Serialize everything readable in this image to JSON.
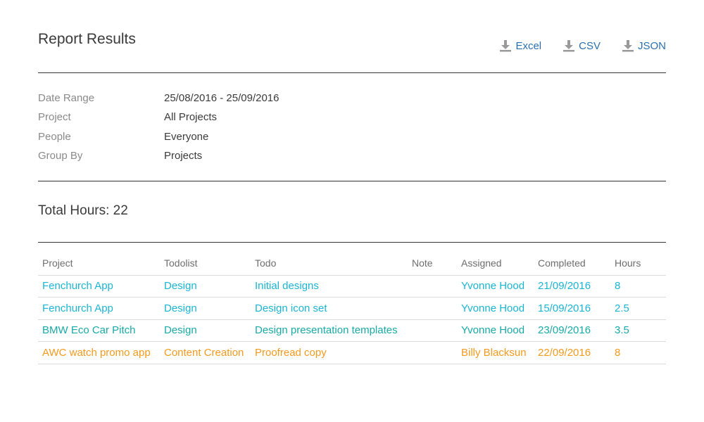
{
  "header": {
    "title": "Report Results",
    "exports": [
      {
        "label": "Excel",
        "icon": "download-icon"
      },
      {
        "label": "CSV",
        "icon": "download-icon"
      },
      {
        "label": "JSON",
        "icon": "download-icon"
      }
    ]
  },
  "filters": [
    {
      "label": "Date Range",
      "value": "25/08/2016 - 25/09/2016"
    },
    {
      "label": "Project",
      "value": "All Projects"
    },
    {
      "label": "People",
      "value": "Everyone"
    },
    {
      "label": "Group By",
      "value": "Projects"
    }
  ],
  "total": {
    "text": "Total Hours: 22"
  },
  "table": {
    "columns": [
      "Project",
      "Todolist",
      "Todo",
      "Note",
      "Assigned",
      "Completed",
      "Hours"
    ],
    "rows": [
      {
        "color": "#1bb5d3",
        "cells": [
          "Fenchurch App",
          "Design",
          "Initial designs",
          "",
          "Yvonne Hood",
          "21/09/2016",
          "8"
        ]
      },
      {
        "color": "#1bb5d3",
        "cells": [
          "Fenchurch App",
          "Design",
          "Design icon set",
          "",
          "Yvonne Hood",
          "15/09/2016",
          "2.5"
        ]
      },
      {
        "color": "#18a9a6",
        "cells": [
          "BMW Eco Car Pitch",
          "Design",
          "Design presentation templates",
          "",
          "Yvonne Hood",
          "23/09/2016",
          "3.5"
        ]
      },
      {
        "color": "#f39a1e",
        "cells": [
          "AWC watch promo app",
          "Content Creation",
          "Proofread copy",
          "",
          "Billy Blacksun",
          "22/09/2016",
          "8"
        ]
      }
    ]
  },
  "colors": {
    "link": "#2a6fad",
    "label_gray": "#8a8a8a",
    "text_dark": "#3a3a3a",
    "rule": "#333333",
    "icon_gray": "#9a9a9a"
  }
}
